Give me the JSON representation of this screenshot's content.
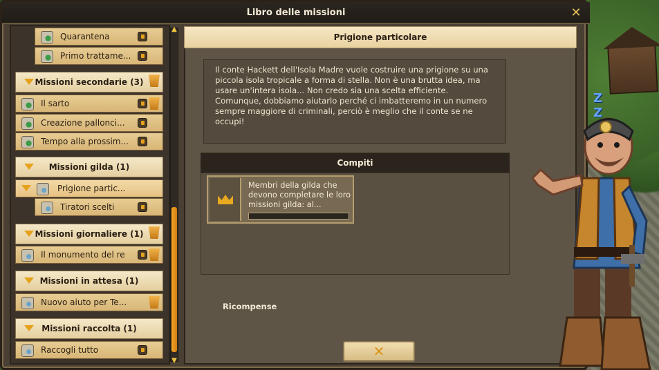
{
  "window": {
    "title": "Libro delle missioni"
  },
  "left_list": [
    {
      "type": "item",
      "indent": true,
      "label": "Quarantena"
    },
    {
      "type": "item",
      "indent": true,
      "label": "Primo trattame..."
    },
    {
      "type": "header",
      "label": "Missioni secondarie (3)"
    },
    {
      "type": "item",
      "indent": false,
      "label": "Il sarto"
    },
    {
      "type": "item",
      "indent": false,
      "label": "Creazione pallonci..."
    },
    {
      "type": "item",
      "indent": false,
      "label": "Tempo alla prossim..."
    },
    {
      "type": "header",
      "label": "Missioni gilda (1)"
    },
    {
      "type": "item",
      "indent": false,
      "label": "Prigione partic..."
    },
    {
      "type": "item",
      "indent": true,
      "label": "Tiratori scelti"
    },
    {
      "type": "header",
      "label": "Missioni giornaliere (1)"
    },
    {
      "type": "item",
      "indent": false,
      "label": "Il monumento del re"
    },
    {
      "type": "header",
      "label": "Missioni in attesa (1)"
    },
    {
      "type": "item",
      "indent": false,
      "label": "Nuovo aiuto per Te..."
    },
    {
      "type": "header",
      "label": "Missioni raccolta (1)"
    },
    {
      "type": "item",
      "indent": false,
      "label": "Raccogli tutto"
    }
  ],
  "quest": {
    "title": "Prigione particolare",
    "description": "Il conte Hackett dell'Isola Madre vuole costruire una prigione su una piccola isola tropicale a forma di stella. Non è una brutta idea, ma usare un'intera isola... Non credo sia una scelta efficiente. Comunque, dobbiamo aiutarlo perché ci imbatteremo in un numero sempre maggiore di criminali, perciò è meglio che il conte se ne occupi!",
    "tasks_heading": "Compiti",
    "task_text": "Membri della gilda che devono completare le loro missioni gilda: al...",
    "task_progress": 0.0,
    "rewards_heading": "Ricompense"
  },
  "colors": {
    "accent": "#e6a21d",
    "panel": "#5f5546",
    "header": "#2b241c"
  }
}
